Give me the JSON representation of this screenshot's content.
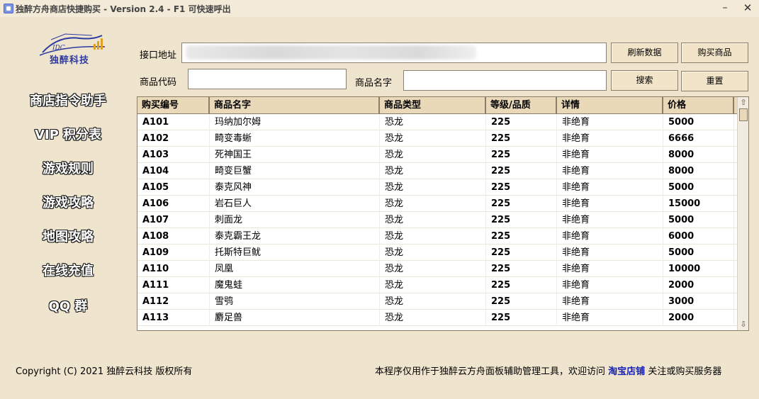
{
  "window": {
    "title": "独醉方舟商店快捷购买 - Version 2.4 - F1 可快速呼出",
    "minimize_icon": "minimize-icon",
    "close_icon": "close-icon"
  },
  "logo": {
    "text": "独醉科技",
    "badge": "IDC"
  },
  "nav": [
    {
      "label": "商店指令助手"
    },
    {
      "label": "VIP 积分表"
    },
    {
      "label": "游戏规则"
    },
    {
      "label": "游戏攻略"
    },
    {
      "label": "地图攻略"
    },
    {
      "label": "在线充值"
    },
    {
      "label": "QQ 群"
    }
  ],
  "form": {
    "api_label": "接口地址",
    "api_value": "",
    "code_label": "商品代码",
    "code_value": "",
    "name_label": "商品名字",
    "name_value": ""
  },
  "buttons": {
    "refresh": "刷新数据",
    "buy": "购买商品",
    "search": "搜索",
    "reset": "重置"
  },
  "table": {
    "columns": [
      "购买编号",
      "商品名字",
      "商品类型",
      "等级/品质",
      "详情",
      "价格"
    ],
    "rows": [
      [
        "A101",
        "玛纳加尔姆",
        "恐龙",
        "225",
        "非绝育",
        "5000"
      ],
      [
        "A102",
        "畸变毒蜥",
        "恐龙",
        "225",
        "非绝育",
        "6666"
      ],
      [
        "A103",
        "死神国王",
        "恐龙",
        "225",
        "非绝育",
        "8000"
      ],
      [
        "A104",
        "畸变巨蟹",
        "恐龙",
        "225",
        "非绝育",
        "8000"
      ],
      [
        "A105",
        "泰克风神",
        "恐龙",
        "225",
        "非绝育",
        "5000"
      ],
      [
        "A106",
        "岩石巨人",
        "恐龙",
        "225",
        "非绝育",
        "15000"
      ],
      [
        "A107",
        "刺面龙",
        "恐龙",
        "225",
        "非绝育",
        "5000"
      ],
      [
        "A108",
        "泰克霸王龙",
        "恐龙",
        "225",
        "非绝育",
        "6000"
      ],
      [
        "A109",
        "托斯特巨鱿",
        "恐龙",
        "225",
        "非绝育",
        "5000"
      ],
      [
        "A110",
        "凤凰",
        "恐龙",
        "225",
        "非绝育",
        "10000"
      ],
      [
        "A111",
        "魔鬼蛙",
        "恐龙",
        "225",
        "非绝育",
        "2000"
      ],
      [
        "A112",
        "雪鸮",
        "恐龙",
        "225",
        "非绝育",
        "3000"
      ],
      [
        "A113",
        "麝足兽",
        "恐龙",
        "225",
        "非绝育",
        "2000"
      ]
    ]
  },
  "footer": {
    "copyright": "Copyright (C) 2021 独醉云科技 版权所有",
    "notice": "本程序仅用作于独醉云方舟面板辅助管理工具，欢迎访问",
    "link": "淘宝店铺",
    "notice_tail": "关注或购买服务器"
  },
  "colors": {
    "background": "#efe5cf",
    "header_bg": "#ead9b9",
    "button_bg": "#f2e4c9",
    "link": "#1520b8"
  }
}
